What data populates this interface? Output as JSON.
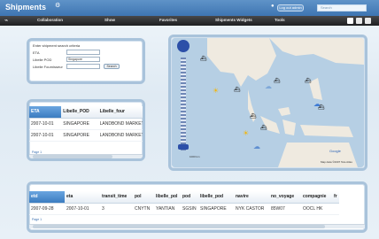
{
  "app": {
    "title": "Shipments",
    "user_label": "Log out admin",
    "search_placeholder": "Search"
  },
  "menu": {
    "items": [
      {
        "label": "Collaboration"
      },
      {
        "label": "Show"
      },
      {
        "label": "Favorites"
      },
      {
        "label": "Shipments Widgets"
      },
      {
        "label": "Tools"
      }
    ]
  },
  "search_form": {
    "title": "Enter shipment search criteria",
    "fields": [
      {
        "label": "ETA",
        "value": ""
      },
      {
        "label": "Libelle POD",
        "value": "Singapore"
      },
      {
        "label": "Libelle Fournisseur",
        "value": ""
      }
    ],
    "button": "Search"
  },
  "small_grid": {
    "columns": [
      "ETA",
      "Libelle_POD",
      "Libelle_four"
    ],
    "rows": [
      [
        "2007-10-01",
        "SINGAPORE",
        "LANDBOND MARKETIN"
      ],
      [
        "2007-10-01",
        "SINGAPORE",
        "LANDBOND MARKETIN"
      ]
    ],
    "pager": "Page 1"
  },
  "map": {
    "scale": "1000 km",
    "copyright": "Map data ©2007 Tele Atlas",
    "logo": "Google"
  },
  "big_grid": {
    "columns": [
      "etd",
      "eta",
      "transit_time",
      "pol",
      "libelle_pol",
      "pod",
      "libelle_pod",
      "navire",
      "no_voyage",
      "compagnie",
      "fr"
    ],
    "rows": [
      [
        "2007-09-28",
        "2007-10-01",
        "3",
        "CNYTN",
        "YANTIAN",
        "SGSIN",
        "SINGAPORE",
        "NYK CASTOR",
        "85W07",
        "OOCL HK",
        ""
      ]
    ],
    "pager": "Page 1"
  }
}
